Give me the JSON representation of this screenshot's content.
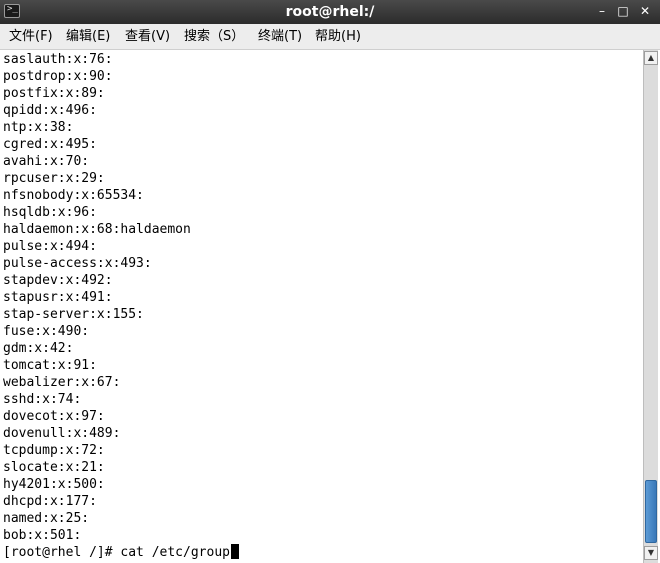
{
  "window": {
    "title": "root@rhel:/",
    "icon_glyph": ">_",
    "controls": {
      "minimize": "–",
      "maximize": "□",
      "close": "✕"
    }
  },
  "menu": [
    {
      "label": "文件(F)"
    },
    {
      "label": "编辑(E)"
    },
    {
      "label": "查看(V)"
    },
    {
      "label": "搜索（S）"
    },
    {
      "label": "终端(T)"
    },
    {
      "label": "帮助(H)"
    }
  ],
  "terminal": {
    "lines": [
      "saslauth:x:76:",
      "postdrop:x:90:",
      "postfix:x:89:",
      "qpidd:x:496:",
      "ntp:x:38:",
      "cgred:x:495:",
      "avahi:x:70:",
      "rpcuser:x:29:",
      "nfsnobody:x:65534:",
      "hsqldb:x:96:",
      "haldaemon:x:68:haldaemon",
      "pulse:x:494:",
      "pulse-access:x:493:",
      "stapdev:x:492:",
      "stapusr:x:491:",
      "stap-server:x:155:",
      "fuse:x:490:",
      "gdm:x:42:",
      "tomcat:x:91:",
      "webalizer:x:67:",
      "sshd:x:74:",
      "dovecot:x:97:",
      "dovenull:x:489:",
      "tcpdump:x:72:",
      "slocate:x:21:",
      "hy4201:x:500:",
      "dhcpd:x:177:",
      "named:x:25:",
      "bob:x:501:"
    ],
    "prompt": "[root@rhel /]# cat /etc/group"
  },
  "scrollbar": {
    "up_glyph": "▲",
    "down_glyph": "▼"
  }
}
